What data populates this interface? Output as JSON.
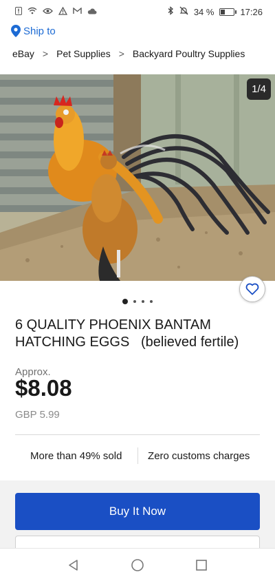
{
  "status_bar": {
    "battery_text": "34 %",
    "battery_level": 0.34,
    "time": "17:26",
    "icons_left": [
      "notification-icon",
      "wifi-icon",
      "eye-icon",
      "warning-icon",
      "gmail-icon",
      "cloud-icon"
    ],
    "icons_right": [
      "bluetooth-icon",
      "mute-icon"
    ]
  },
  "ship_to": {
    "label": "Ship to"
  },
  "breadcrumb": {
    "items": [
      "eBay",
      "Pet Supplies",
      "Backyard Poultry Supplies"
    ]
  },
  "gallery": {
    "counter": "1/4",
    "dots_count": 4,
    "active_index": 0
  },
  "listing": {
    "title": "6 QUALITY PHOENIX BANTAM HATCHING EGGS   (believed fertile)",
    "approx_label": "Approx.",
    "price": "$8.08",
    "original_price": "GBP 5.99"
  },
  "stats": {
    "sold": "More than 49% sold",
    "customs": "Zero customs charges"
  },
  "actions": {
    "buy_now": "Buy It Now"
  },
  "colors": {
    "accent_link": "#1d6bd4",
    "buy_button": "#1a4fc4"
  }
}
